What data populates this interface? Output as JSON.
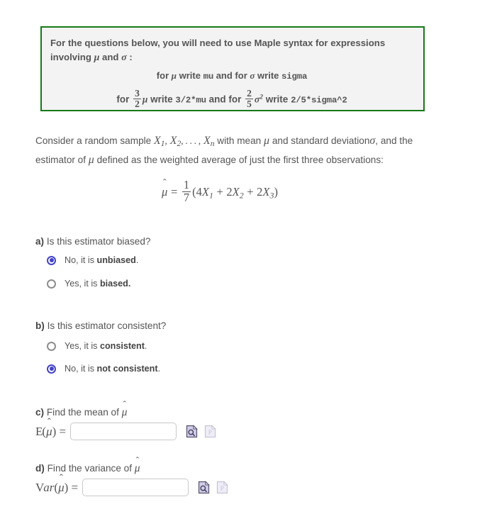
{
  "maple_box": {
    "accent_color": "#147a16",
    "background_color": "#f3f3f3",
    "lead_line1": "For the questions below, you will need to use Maple syntax for expressions",
    "lead_line2_prefix": "involving",
    "lead_mu": "μ",
    "lead_and": "and",
    "lead_sigma": "σ",
    "lead_colon": ":",
    "rule1_for": "for",
    "rule1_mu": "μ",
    "rule1_write": "write",
    "rule1_code_mu": "mu",
    "rule1_andfor": "and for",
    "rule1_sigma": "σ",
    "rule1_write2": "write",
    "rule1_code_sigma": "sigma",
    "rule2_for": "for",
    "rule2_frac_num": "3",
    "rule2_frac_den": "2",
    "rule2_mu": "μ",
    "rule2_write": "write",
    "rule2_code": "3/2*mu",
    "rule2_andfor": "and  for",
    "rule2_frac2_num": "2",
    "rule2_frac2_den": "5",
    "rule2_sigma": "σ",
    "rule2_sigma_exp": "2",
    "rule2_write2": "write",
    "rule2_code2": "2/5*sigma^2"
  },
  "problem": {
    "text_a": "Consider a random sample",
    "x1": "X",
    "x1_sub": "1",
    "comma1": ",",
    "x2": "X",
    "x2_sub": "2",
    "ellipsis": ", . . . ,",
    "xn": "X",
    "xn_sub": "n",
    "text_b": "with mean",
    "mu": "μ",
    "text_c": "and standard deviation",
    "sigma": "σ",
    "text_d": ",",
    "line2_a": "and the estimator of",
    "line2_mu": "μ",
    "line2_b": "defined as the weighted average of just the first three",
    "line3": "observations:",
    "formula": {
      "muhat": "μ",
      "hat": "ˆ",
      "equals": "=",
      "frac_num": "1",
      "frac_den": "7",
      "open": "(",
      "t1_coef": "4",
      "t1_var": "X",
      "t1_sub": "1",
      "plus1": "+",
      "t2_coef": "2",
      "t2_var": "X",
      "t2_sub": "2",
      "plus2": "+",
      "t3_coef": "2",
      "t3_var": "X",
      "t3_sub": "3",
      "close": ")"
    }
  },
  "questions": [
    {
      "id": "a",
      "marker": "a)",
      "prompt": "Is this estimator biased?",
      "options": [
        {
          "plain": "No, it is ",
          "bold": "unbiased",
          "tail": ".",
          "selected": true
        },
        {
          "plain": "Yes, it is ",
          "bold": "biased.",
          "tail": "",
          "selected": false
        }
      ]
    },
    {
      "id": "b",
      "marker": "b)",
      "prompt": "Is this estimator consistent?",
      "options": [
        {
          "plain": "Yes, it is ",
          "bold": "consistent",
          "tail": ".",
          "selected": false
        },
        {
          "plain": "No, it is ",
          "bold": "not consistent",
          "tail": ".",
          "selected": true
        }
      ]
    }
  ],
  "answer_c": {
    "marker": "c)",
    "prompt": "Find the mean of",
    "prompt_symbol": "μ",
    "prompt_hat": "ˆ",
    "lhs_e": "E",
    "lhs_open": "(",
    "lhs_mu": "μ",
    "lhs_hat": "ˆ",
    "lhs_close": ")",
    "lhs_equals": "=",
    "value": "",
    "placeholder": "",
    "preview_icon": "document-magnifier-icon",
    "palette_icon": "document-palette-icon"
  },
  "answer_d": {
    "marker": "d)",
    "prompt": "Find the variance of",
    "prompt_symbol": "μ",
    "prompt_hat": "ˆ",
    "lhs_v": "V",
    "lhs_ar": "ar",
    "lhs_open": "(",
    "lhs_mu": "μ",
    "lhs_hat": "ˆ",
    "lhs_close": ")",
    "lhs_equals": "=",
    "value": "",
    "placeholder": "",
    "preview_icon": "document-magnifier-icon",
    "palette_icon": "document-palette-icon"
  },
  "colors": {
    "radio_selected": "#4343c8",
    "radio_unselected": "#8d8d8d",
    "text": "#555555",
    "box_border": "#147a16",
    "input_border": "#c9c9c9",
    "icon_fill": "#cfcbe8",
    "icon_disabled": "#e2e0ef"
  }
}
